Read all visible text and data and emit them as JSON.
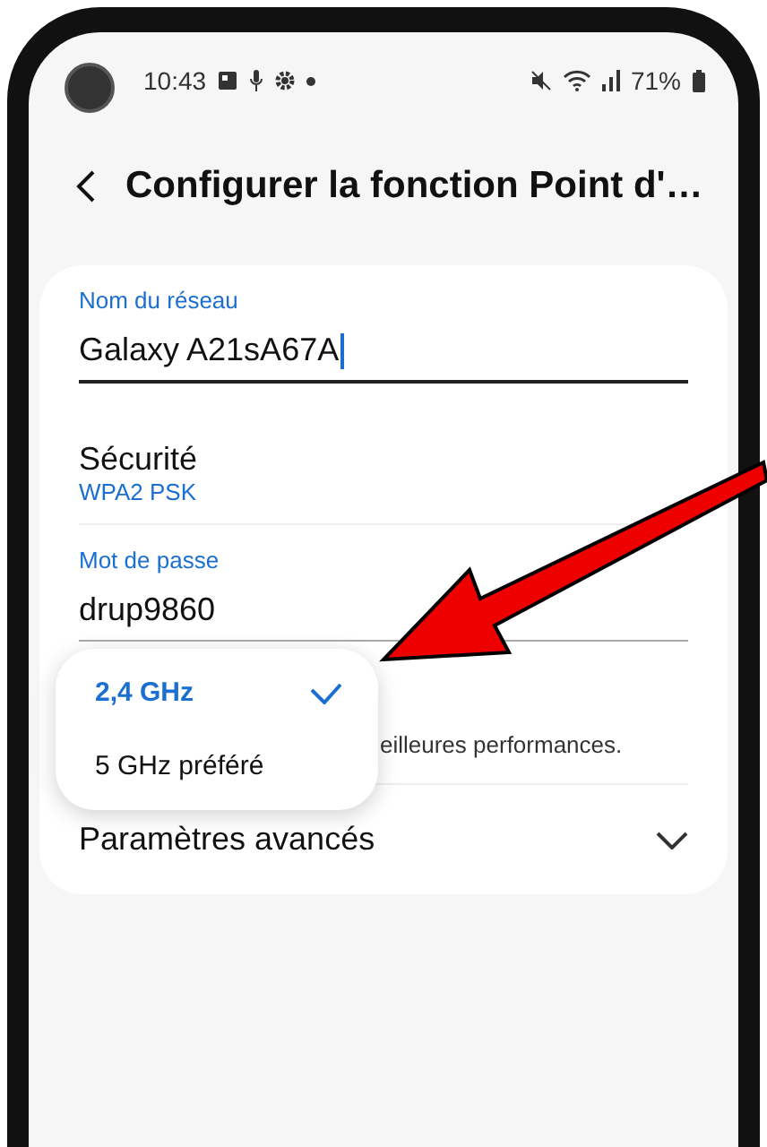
{
  "status_bar": {
    "time": "10:43",
    "battery": "71%"
  },
  "header": {
    "title": "Configurer la fonction Point d'…"
  },
  "form": {
    "network_name": {
      "label": "Nom du réseau",
      "value": "Galaxy A21sA67A"
    },
    "security": {
      "label": "Sécurité",
      "value": "WPA2 PSK"
    },
    "password": {
      "label": "Mot de passe",
      "value": "drup9860"
    },
    "band_hint": "eilleures performances.",
    "advanced": {
      "label": "Paramètres avancés",
      "expanded": false
    }
  },
  "band_menu": [
    {
      "label": "2,4 GHz",
      "selected": true
    },
    {
      "label": "5 GHz préféré",
      "selected": false
    }
  ]
}
